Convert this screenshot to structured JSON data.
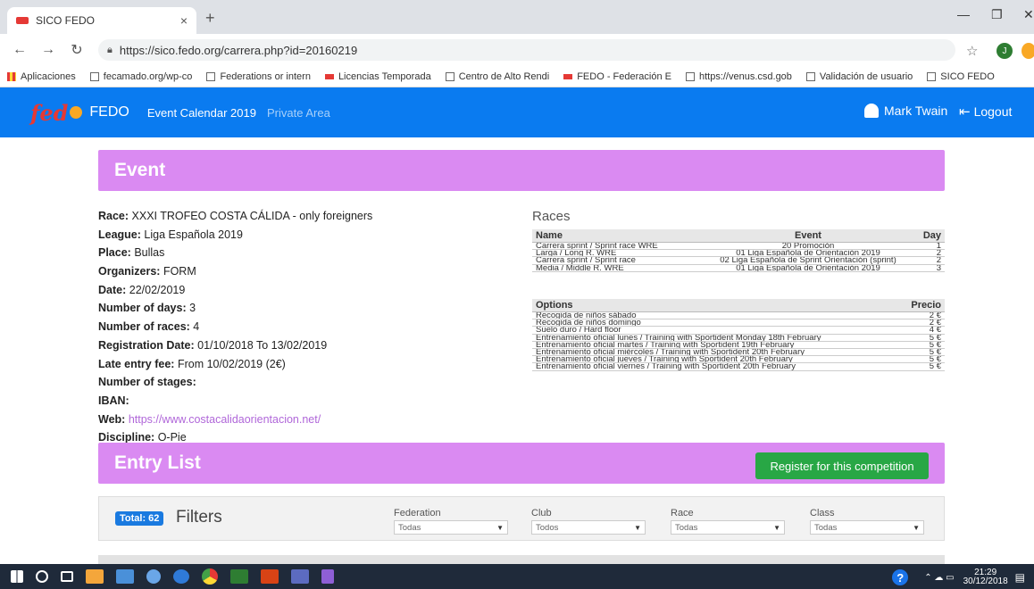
{
  "browser": {
    "tab_title": "SICO FEDO",
    "url": "https://sico.fedo.org/carrera.php?id=20160219",
    "profile_initial": "J",
    "bookmarks": [
      "Aplicaciones",
      "fecamado.org/wp-co",
      "Federations or intern",
      "Licencias Temporada",
      "Centro de Alto Rendi",
      "FEDO - Federación E",
      "https://venus.csd.gob",
      "Validación de usuario",
      "SICO FEDO"
    ]
  },
  "header": {
    "logo": "fed",
    "brand": "FEDO",
    "nav_calendar": "Event Calendar 2019",
    "nav_private": "Private Area",
    "user_name": "Mark Twain",
    "logout": "Logout"
  },
  "event": {
    "title": "Event",
    "details": [
      {
        "label": "Race:",
        "value": "XXXI TROFEO COSTA CÁLIDA - only foreigners"
      },
      {
        "label": "League:",
        "value": "Liga Española 2019"
      },
      {
        "label": "Place:",
        "value": "Bullas"
      },
      {
        "label": "Organizers:",
        "value": "FORM"
      },
      {
        "label": "Date:",
        "value": "22/02/2019"
      },
      {
        "label": "Number of days:",
        "value": "3"
      },
      {
        "label": "Number of races:",
        "value": "4"
      },
      {
        "label": "Registration Date:",
        "value": "01/10/2018 To 13/02/2019"
      },
      {
        "label": "Late entry fee:",
        "value": "From 10/02/2019 (2€)"
      },
      {
        "label": "Number of stages:",
        "value": ""
      },
      {
        "label": "IBAN:",
        "value": ""
      },
      {
        "label": "Web:",
        "value": "https://www.costacalidaorientacion.net/"
      },
      {
        "label": "Discipline:",
        "value": "O-Pie"
      }
    ]
  },
  "races": {
    "title": "Races",
    "headers": [
      "Name",
      "Event",
      "Day"
    ],
    "rows": [
      [
        "Carrera sprint / Sprint race WRE",
        "20 Promoción",
        "1"
      ],
      [
        "Larga / Long R. WRE",
        "01 Liga Española de Orientación 2019",
        "2"
      ],
      [
        "Carrera sprint / Sprint race",
        "02 Liga Española de Sprint Orientación (sprint)",
        "2"
      ],
      [
        "Media / Middle R. WRE",
        "01 Liga Española de Orientación 2019",
        "3"
      ]
    ]
  },
  "options": {
    "headers": [
      "Options",
      "Precio"
    ],
    "rows": [
      [
        "Recogida de niños sábado",
        "2 €"
      ],
      [
        "Recogida de niños domingo",
        "2 €"
      ],
      [
        "Suelo duro / Hard floor",
        "4 €"
      ],
      [
        "Entrenamiento oficial lunes / Training with Sportident Monday 18th February",
        "5 €"
      ],
      [
        "Entrenamiento oficial martes / Training with Sportident 19th February",
        "5 €"
      ],
      [
        "Entrenamiento oficial miércoles / Training with Sportident 20th February",
        "5 €"
      ],
      [
        "Entrenamiento oficial jueves / Training with Sportident 20th February",
        "5 €"
      ],
      [
        "Entrenamiento oficial viernes / Training with Sportident 20th February",
        "5 €"
      ]
    ]
  },
  "entry": {
    "title": "Entry List",
    "register_label": "Register for this competition",
    "total_badge": "Total: 62",
    "filters_title": "Filters",
    "filters": [
      {
        "label": "Federation",
        "value": "Todas"
      },
      {
        "label": "Club",
        "value": "Todos"
      },
      {
        "label": "Race",
        "value": "Todas"
      },
      {
        "label": "Class",
        "value": "Todas"
      }
    ]
  },
  "taskbar": {
    "time": "21:29",
    "date": "30/12/2018"
  }
}
